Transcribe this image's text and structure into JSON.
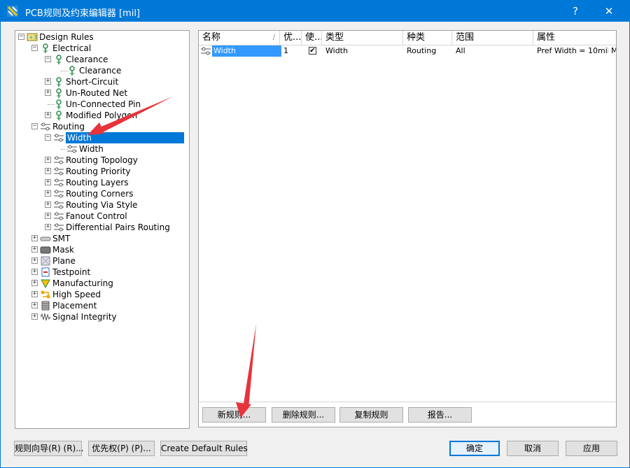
{
  "window": {
    "title": "PCB规则及约束编辑器 [mil]",
    "help_label": "?",
    "close_label": "✕"
  },
  "tree": [
    {
      "label": "Design Rules",
      "icon": "design-rules-icon",
      "level": 0,
      "expander": "−"
    },
    {
      "label": "Electrical",
      "icon": "electrical-icon",
      "level": 1,
      "expander": "−"
    },
    {
      "label": "Clearance",
      "icon": "clearance-icon",
      "level": 2,
      "expander": "−"
    },
    {
      "label": "Clearance",
      "icon": "clearance-icon",
      "level": 3,
      "expander": ""
    },
    {
      "label": "Short-Circuit",
      "icon": "short-circuit-icon",
      "level": 2,
      "expander": "+"
    },
    {
      "label": "Un-Routed Net",
      "icon": "unrouted-net-icon",
      "level": 2,
      "expander": "+"
    },
    {
      "label": "Un-Connected Pin",
      "icon": "unconnected-pin-icon",
      "level": 2,
      "expander": ""
    },
    {
      "label": "Modified Polygon",
      "icon": "modified-polygon-icon",
      "level": 2,
      "expander": "+"
    },
    {
      "label": "Routing",
      "icon": "routing-icon",
      "level": 1,
      "expander": "−"
    },
    {
      "label": "Width",
      "icon": "width-rule-icon",
      "level": 2,
      "expander": "−",
      "selected": true
    },
    {
      "label": "Width",
      "icon": "width-rule-icon",
      "level": 3,
      "expander": ""
    },
    {
      "label": "Routing Topology",
      "icon": "routing-topology-icon",
      "level": 2,
      "expander": "+"
    },
    {
      "label": "Routing Priority",
      "icon": "routing-priority-icon",
      "level": 2,
      "expander": "+"
    },
    {
      "label": "Routing Layers",
      "icon": "routing-layers-icon",
      "level": 2,
      "expander": "+"
    },
    {
      "label": "Routing Corners",
      "icon": "routing-corners-icon",
      "level": 2,
      "expander": "+"
    },
    {
      "label": "Routing Via Style",
      "icon": "routing-via-style-icon",
      "level": 2,
      "expander": "+"
    },
    {
      "label": "Fanout Control",
      "icon": "fanout-control-icon",
      "level": 2,
      "expander": "+"
    },
    {
      "label": "Differential Pairs Routing",
      "icon": "differential-pairs-icon",
      "level": 2,
      "expander": "+"
    },
    {
      "label": "SMT",
      "icon": "smt-icon",
      "level": 1,
      "expander": "+"
    },
    {
      "label": "Mask",
      "icon": "mask-icon",
      "level": 1,
      "expander": "+"
    },
    {
      "label": "Plane",
      "icon": "plane-icon",
      "level": 1,
      "expander": "+"
    },
    {
      "label": "Testpoint",
      "icon": "testpoint-icon",
      "level": 1,
      "expander": "+"
    },
    {
      "label": "Manufacturing",
      "icon": "manufacturing-icon",
      "level": 1,
      "expander": "+"
    },
    {
      "label": "High Speed",
      "icon": "high-speed-icon",
      "level": 1,
      "expander": "+"
    },
    {
      "label": "Placement",
      "icon": "placement-icon",
      "level": 1,
      "expander": "+"
    },
    {
      "label": "Signal Integrity",
      "icon": "signal-integrity-icon",
      "level": 1,
      "expander": "+"
    }
  ],
  "grid": {
    "columns": [
      "名称",
      "优...",
      "使...",
      "类型",
      "种类",
      "范围",
      "属性"
    ],
    "sort_indicator": "/",
    "rows": [
      {
        "name": "Width",
        "priority": "1",
        "enabled": "✔",
        "type": "Width",
        "kind": "Routing",
        "scope": "All",
        "attributes": "Pref Width = 10mil",
        "attributes_more": "M"
      }
    ]
  },
  "rule_buttons": {
    "new": "新规则...",
    "delete": "删除规则...",
    "copy": "复制规则",
    "report": "报告..."
  },
  "footer": {
    "wizard": "规则向导(R) (R)...",
    "priorities": "优先权(P) (P)...",
    "create_default": "Create Default Rules",
    "ok": "确定",
    "cancel": "取消",
    "apply": "应用"
  },
  "colors": {
    "title_bar": "#0078d7",
    "selection": "#0078d7",
    "annotation_arrow": "#e8333b"
  }
}
